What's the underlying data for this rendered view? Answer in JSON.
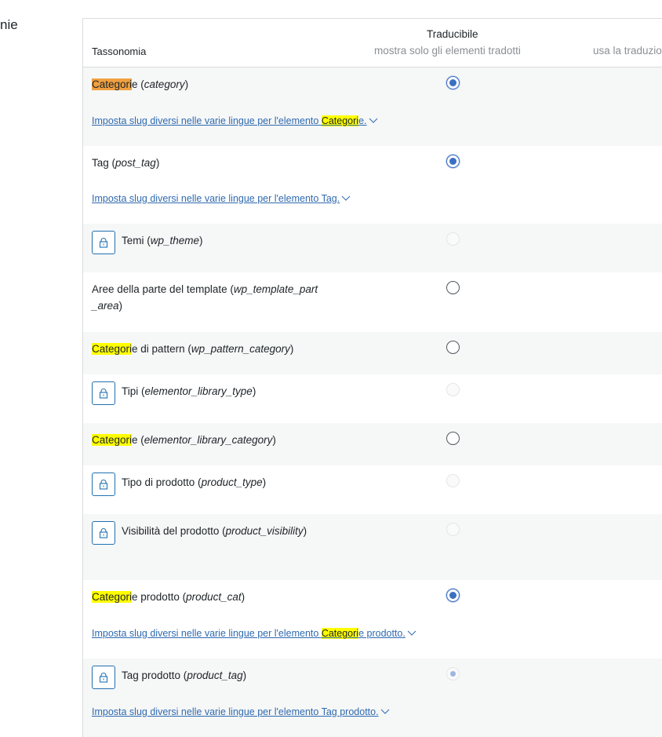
{
  "section_title": "nie",
  "header": {
    "taxonomy": "Tassonomia",
    "translatable": "Traducibile",
    "option_1": "mostra solo gli elementi tradotti",
    "option_2": "usa la traduzione"
  },
  "link_prefix": "Imposta slug diversi nelle varie lingue per l'elemento ",
  "rows": [
    {
      "hl": "Categori",
      "hl_active": true,
      "rest": "e",
      "slug": "category",
      "locked": false,
      "radio": "checked",
      "link": {
        "hl": "Categori",
        "rest": "e."
      },
      "height": 100
    },
    {
      "hl": "",
      "rest": "Tag",
      "slug": "post_tag",
      "locked": false,
      "radio": "checked",
      "link": {
        "hl": "",
        "rest": "Tag."
      },
      "height": 99
    },
    {
      "hl": "",
      "rest": "Temi",
      "slug": "wp_theme",
      "locked": true,
      "radio": "disabled",
      "height": 62
    },
    {
      "hl": "",
      "rest": "Aree della parte del template",
      "slug": "wp_template_part_area",
      "locked": false,
      "radio": "unchecked",
      "height": 76
    },
    {
      "hl": "Categori",
      "rest": "e di pattern",
      "slug": "wp_pattern_category",
      "locked": false,
      "radio": "unchecked",
      "height": 54
    },
    {
      "hl": "",
      "rest": "Tipi",
      "slug": "elementor_library_type",
      "locked": true,
      "radio": "disabled",
      "height": 62
    },
    {
      "hl": "Categori",
      "rest": "e",
      "slug": "elementor_library_category",
      "locked": false,
      "radio": "unchecked",
      "height": 54
    },
    {
      "hl": "",
      "rest": "Tipo di prodotto",
      "slug": "product_type",
      "locked": true,
      "radio": "disabled",
      "height": 62
    },
    {
      "hl": "",
      "rest": "Visibilità del prodotto",
      "slug": "product_visibility",
      "locked": true,
      "radio": "disabled",
      "height": 84
    },
    {
      "hl": "Categori",
      "rest": "e prodotto",
      "slug": "product_cat",
      "locked": false,
      "radio": "checked",
      "link": {
        "hl": "Categori",
        "rest": "e prodotto."
      },
      "height": 100
    },
    {
      "hl": "",
      "rest": "Tag prodotto",
      "slug": "product_tag",
      "locked": true,
      "radio": "disabled-checked",
      "link": {
        "hl": "",
        "rest": "Tag prodotto."
      },
      "height": 100
    }
  ]
}
